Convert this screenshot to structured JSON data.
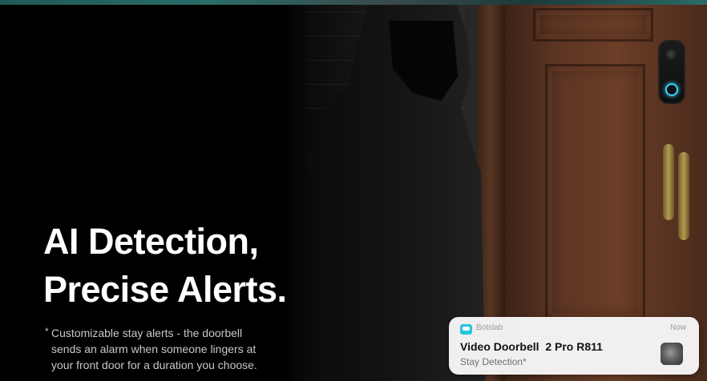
{
  "hero": {
    "headline_line1": "AI Detection,",
    "headline_line2": "Precise Alerts.",
    "footnote_marker": "*",
    "footnote_lines": [
      "Customizable stay alerts - the doorbell",
      "sends an alarm when someone lingers at",
      "your front door for a duration you choose."
    ]
  },
  "notification": {
    "app_name": "Botslab",
    "time": "Now",
    "title": "Video Doorbell  2 Pro R811",
    "body": "Stay Detection*",
    "app_icon": "botslab-app-icon",
    "thumbnail": "camera-snapshot-thumbnail"
  },
  "colors": {
    "background": "#000000",
    "headline": "#ffffff",
    "footnote": "#c8c8c8",
    "door": "#5c3522",
    "doorbell_ring": "#3ad6ff",
    "app_icon": "#24c7d9",
    "card": "#f8f8f8"
  }
}
